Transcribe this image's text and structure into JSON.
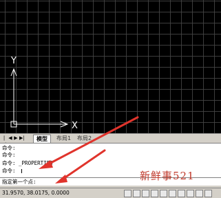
{
  "ucs": {
    "y_label": "Y",
    "x_label": "X"
  },
  "tabs": {
    "nav_buttons": [
      "|◀",
      "◀",
      "▶",
      "▶|"
    ],
    "model": "模型",
    "layout1": "布局1",
    "layout2": "布局2"
  },
  "command_history": [
    "命令:",
    "命令:",
    "命令: _PROPERTIES",
    "命令:"
  ],
  "prompt": "指定第一个点:",
  "status": {
    "coordinates": "31.9570, 38.0175, 0.0000"
  },
  "watermark": "新鲜事521",
  "colors": {
    "canvas": "#000000",
    "grid": "#464646",
    "ucs": "#ffffff",
    "annotation_arrow": "#e0342c"
  }
}
